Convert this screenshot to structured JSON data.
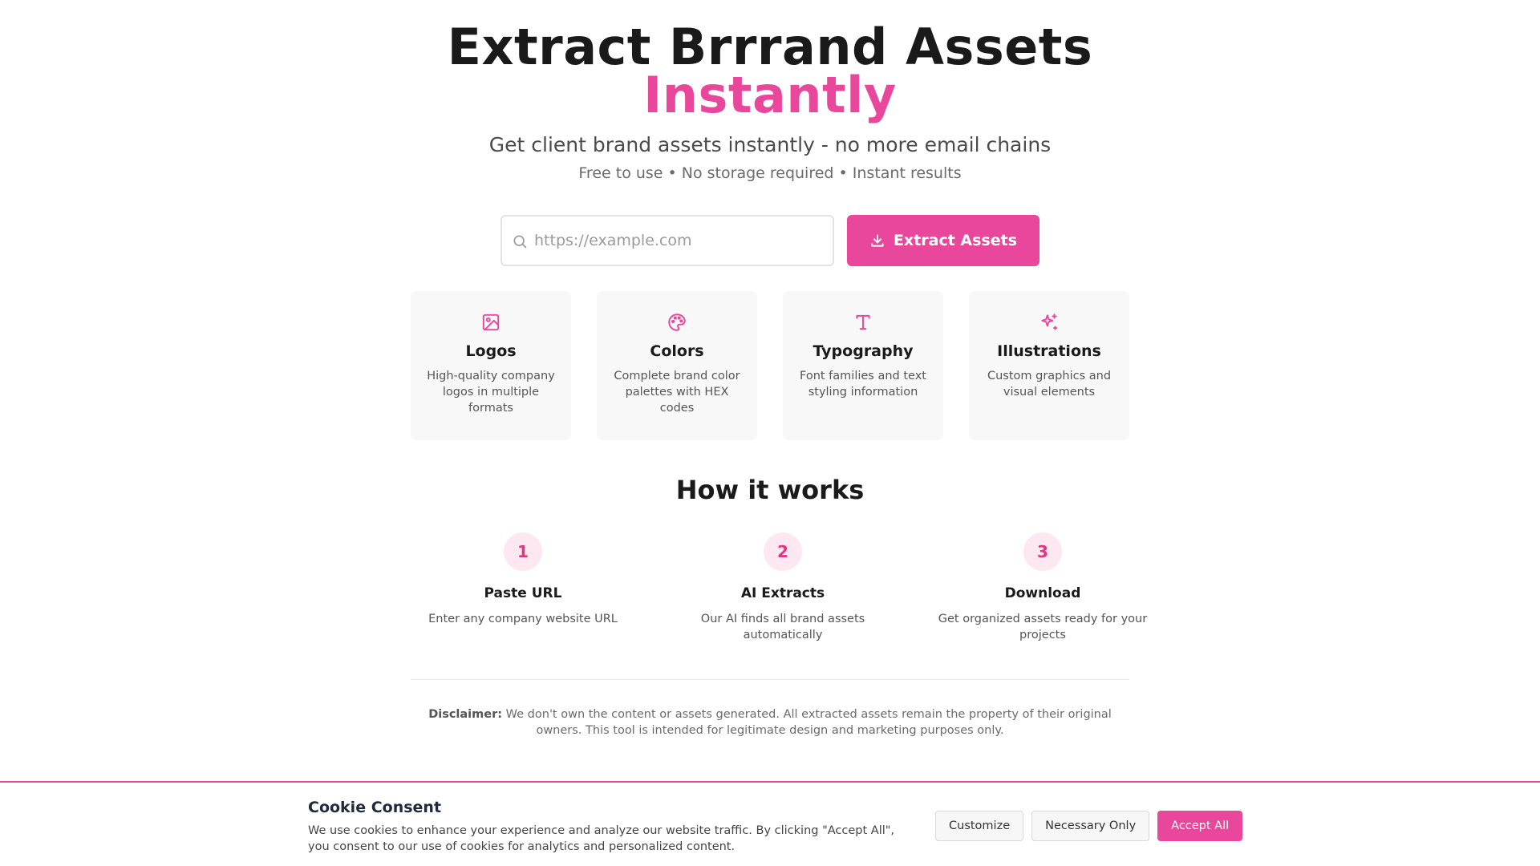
{
  "hero": {
    "title_line1": "Extract Brrrand Assets",
    "title_line2": "Instantly",
    "subtitle": "Get client brand assets instantly - no more email chains",
    "tagline": "Free to use • No storage required • Instant results"
  },
  "extract": {
    "input_value": "",
    "input_placeholder": "https://example.com",
    "button_label": "Extract Assets"
  },
  "features": [
    {
      "icon": "image-icon",
      "title": "Logos",
      "desc": "High-quality company logos in multiple formats"
    },
    {
      "icon": "palette-icon",
      "title": "Colors",
      "desc": "Complete brand color palettes with HEX codes"
    },
    {
      "icon": "type-icon",
      "title": "Typography",
      "desc": "Font families and text styling information"
    },
    {
      "icon": "sparkles-icon",
      "title": "Illustrations",
      "desc": "Custom graphics and visual elements"
    }
  ],
  "how_it_works": {
    "title": "How it works",
    "steps": [
      {
        "num": "1",
        "title": "Paste URL",
        "desc": "Enter any company website URL"
      },
      {
        "num": "2",
        "title": "AI Extracts",
        "desc": "Our AI finds all brand assets automatically"
      },
      {
        "num": "3",
        "title": "Download",
        "desc": "Get organized assets ready for your projects"
      }
    ]
  },
  "disclaimer": {
    "label": "Disclaimer:",
    "text": "We don't own the content or assets generated. All extracted assets remain the property of their original owners. This tool is intended for legitimate design and marketing purposes only."
  },
  "cookie": {
    "title": "Cookie Consent",
    "body": "We use cookies to enhance your experience and analyze our website traffic. By clicking \"Accept All\", you consent to our use of cookies for analytics and personalized content.",
    "customize_label": "Customize",
    "necessary_label": "Necessary Only",
    "accept_label": "Accept All"
  },
  "colors": {
    "accent": "#e8479b",
    "step_bg": "#fde8f2",
    "card_bg": "#f8f8f8"
  }
}
